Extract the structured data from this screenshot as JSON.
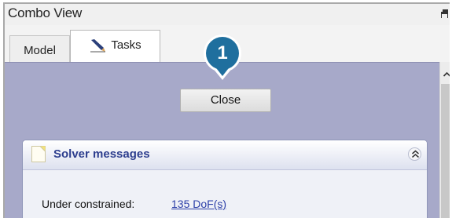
{
  "window": {
    "title": "Combo View"
  },
  "tabs": [
    {
      "label": "Model",
      "active": false
    },
    {
      "label": "Tasks",
      "active": true,
      "icon": "pencil-icon"
    }
  ],
  "task_panel": {
    "close_label": "Close"
  },
  "callout": {
    "number": "1",
    "color": "#1f6f9e"
  },
  "solver_messages": {
    "title": "Solver messages",
    "icon": "note-icon",
    "collapse_icon": "chevron-double-up-icon",
    "status_label": "Under constrained:",
    "dof_link": "135 DoF(s)"
  },
  "colors": {
    "content_background": "#a7a9c9",
    "panel_title": "#2d3e8e",
    "link": "#2c3fa8"
  }
}
